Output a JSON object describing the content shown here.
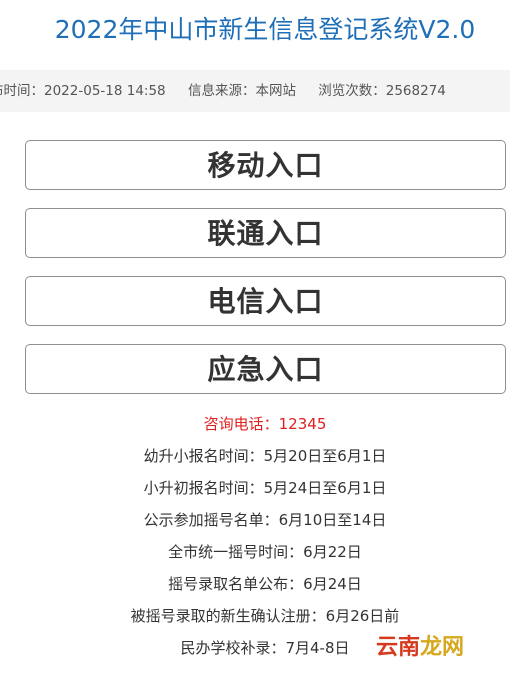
{
  "header": {
    "title": "2022年中山市新生信息登记系统V2.0"
  },
  "meta": {
    "publish_time": "布时间：2022-05-18 14:58",
    "source": "信息来源：本网站",
    "views": "浏览次数：2568274"
  },
  "entries": [
    {
      "label": "移动入口"
    },
    {
      "label": "联通入口"
    },
    {
      "label": "电信入口"
    },
    {
      "label": "应急入口"
    }
  ],
  "info": {
    "hotline": "咨询电话：12345",
    "lines": [
      "幼升小报名时间：5月20日至6月1日",
      "小升初报名时间：5月24日至6月1日",
      "公示参加摇号名单：6月10日至14日",
      "全市统一摇号时间：6月22日",
      "摇号录取名单公布：6月24日",
      "被摇号录取的新生确认注册：6月26日前",
      "民办学校补录：7月4-8日"
    ]
  },
  "watermark": {
    "part1": "云南",
    "part2": "龙网"
  },
  "colors": {
    "title": "#1f6fb8",
    "hotline": "#e02020",
    "meta_bar_bg": "#f4f4f4"
  }
}
